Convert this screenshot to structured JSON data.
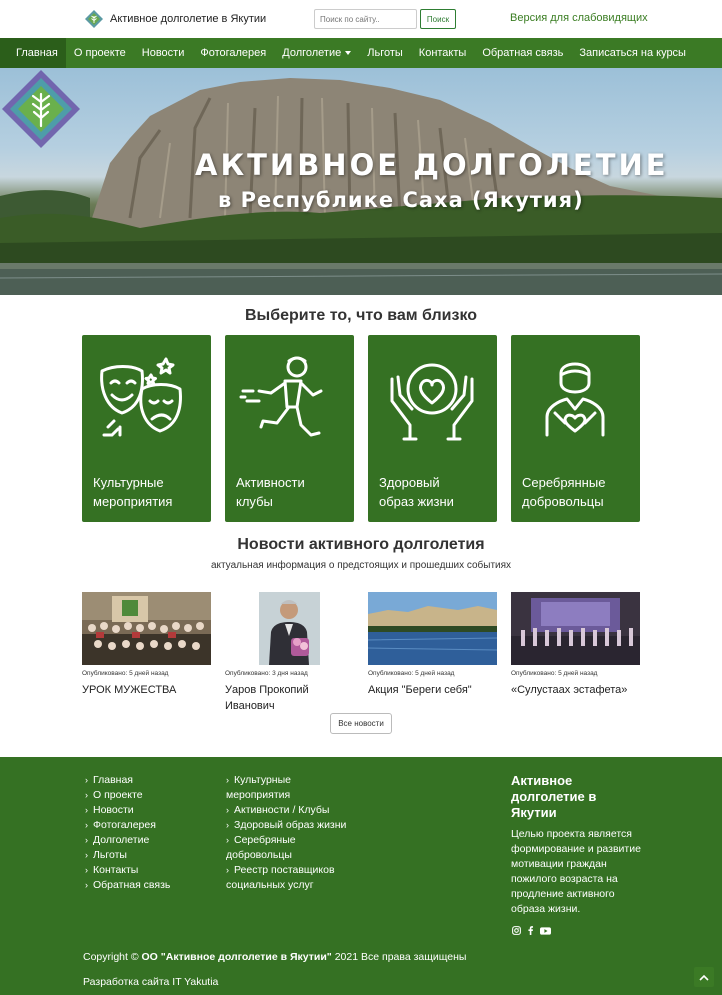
{
  "header": {
    "site_name": "Активное долголетие в Якутии",
    "search_placeholder": "Поиск по сайту..",
    "search_button": "Поиск",
    "low_vision_link": "Версия для слабовидящих"
  },
  "nav": {
    "items": [
      {
        "label": "Главная",
        "active": true
      },
      {
        "label": "О проекте"
      },
      {
        "label": "Новости"
      },
      {
        "label": "Фотогалерея"
      },
      {
        "label": "Долголетие",
        "dropdown": true
      },
      {
        "label": "Льготы"
      },
      {
        "label": "Контакты"
      },
      {
        "label": "Обратная связь"
      },
      {
        "label": "Записаться на курсы"
      }
    ]
  },
  "hero": {
    "title": "АКТИВНОЕ ДОЛГОЛЕТИЕ",
    "subtitle": "в Республике Саха (Якутия)"
  },
  "choose": {
    "heading": "Выберите то, что вам близко",
    "tiles": [
      {
        "line1": "Культурные",
        "line2": "мероприятия",
        "icon": "theater-masks-icon"
      },
      {
        "line1": "Активности",
        "line2": "клубы",
        "icon": "running-man-icon"
      },
      {
        "line1": "Здоровый",
        "line2": "образ жизни",
        "icon": "hands-heart-icon"
      },
      {
        "line1": "Серебрянные",
        "line2": "добровольцы",
        "icon": "volunteer-heart-icon"
      }
    ]
  },
  "news": {
    "heading": "Новости активного долголетия",
    "subheading": "актуальная информация о предстоящих и прошедших событиях",
    "items": [
      {
        "meta": "Опубликовано: 5 дней назад",
        "title": "УРОК МУЖЕСТВА"
      },
      {
        "meta": "Опубликовано: 3 дня назад",
        "title": "Уаров Прокопий Иванович"
      },
      {
        "meta": "Опубликовано: 5 дней назад",
        "title": "Акция \"Береги себя\""
      },
      {
        "meta": "Опубликовано: 5 дней назад",
        "title": "«Сулустаах эстафета»"
      }
    ],
    "all_button": "Все новости"
  },
  "footer": {
    "col1": [
      "Главная",
      "О проекте",
      "Новости",
      "Фотогалерея",
      "Долголетие",
      "Льготы",
      "Контакты",
      "Обратная связь"
    ],
    "col2": [
      {
        "l1": "Культурные",
        "l2": "мероприятия"
      },
      {
        "l1": "Активности / Клубы"
      },
      {
        "l1": "Здоровый образ жизни"
      },
      {
        "l1": "Серебряные",
        "l2": "добровольцы"
      },
      {
        "l1": "Реестр поставщиков",
        "l2": "социальных услуг"
      }
    ],
    "about_title": "Активное долголетие в Якутии",
    "about_text": "Целью проекта является формирование и развитие мотивации граждан пожилого возраста на продление активного образа жизни.",
    "social": [
      "instagram-icon",
      "facebook-icon",
      "youtube-icon"
    ],
    "copyright_prefix": "Copyright ©",
    "copyright_org": "ОО \"Активное долголетие в Якутии\"",
    "copyright_suffix": "2021 Все права защищены",
    "developer": "Разработка сайта IT Yakutia"
  },
  "colors": {
    "primary_green": "#357123",
    "nav_green": "#3b7a25",
    "active_nav": "#2b5e1a"
  }
}
